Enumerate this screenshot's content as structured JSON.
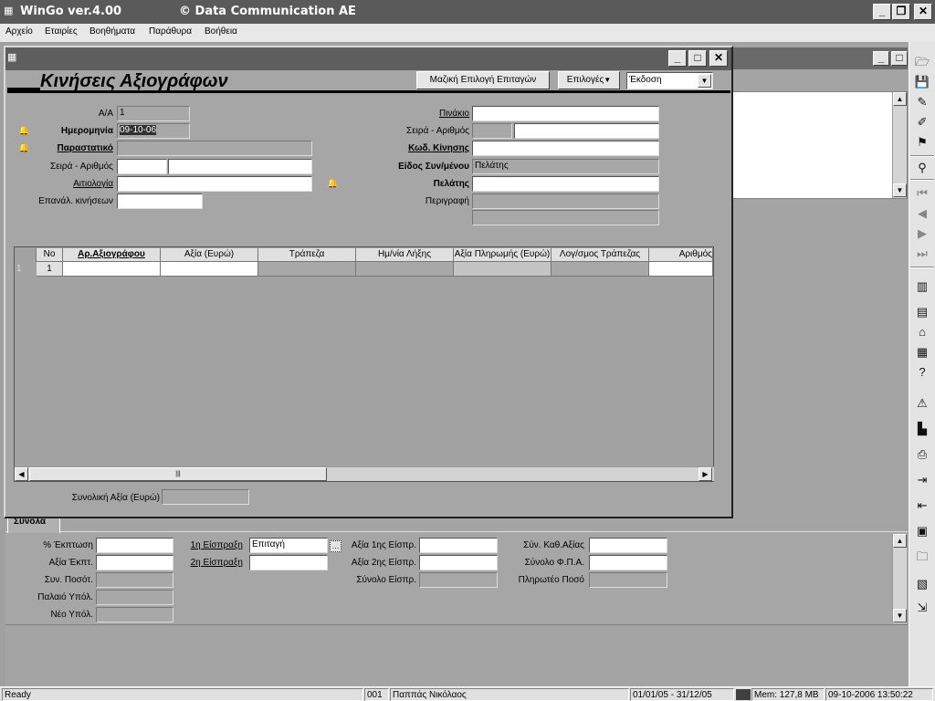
{
  "app": {
    "title": "WinGo ver.4.00",
    "company": "© Data Communication AE"
  },
  "menu": [
    "Αρχείο",
    "Εταιρίες",
    "Βοηθήματα",
    "Παράθυρα",
    "Βοήθεια"
  ],
  "form": {
    "title": "Κινήσεις Αξιογράφων",
    "btn_mass": "Μαζική Επιλογή Επιταγών",
    "btn_options": "Επιλογές",
    "edition": "Έκδοση",
    "left": {
      "aa_label": "Α/Α",
      "aa_value": "1",
      "date_label": "Ημερομηνία",
      "date_value": "09-10-06",
      "parastatiko_label": "Παραστατικό",
      "seira_label": "Σειρά - Αριθμός",
      "aitiologia_label": "Αιτιολογία",
      "epanal_label": "Επανάλ. κινήσεων"
    },
    "right": {
      "pinakio_label": "Πινάκιο",
      "seira_label": "Σειρά - Αριθμός",
      "kod_label": "Κωδ. Κίνησης",
      "eidos_label": "Είδος Συν/μένου",
      "eidos_value": "Πελάτης",
      "pelatis_label": "Πελάτης",
      "perigrafi_label": "Περιγραφή"
    },
    "grid": {
      "headers": [
        "Νο",
        "Αρ.Αξιογράφου",
        "Αξία (Ευρώ)",
        "Τράπεζα",
        "Ημ/νία Λήξης",
        "Αξία Πληρωμής (Ευρώ)",
        "Λογ/σμος Τράπεζας",
        "Αριθμός"
      ],
      "row_index": "1",
      "row_no": "1"
    },
    "total_label": "Συνολική Αξία (Ευρώ)"
  },
  "bottom": {
    "tab": "Σύνολα",
    "col1": [
      "% Έκπτωση",
      "Αξία Έκπτ.",
      "Συν. Ποσότ.",
      "Παλαιό Υπόλ.",
      "Νέο Υπόλ."
    ],
    "eispraxi1_label": "1η Είσπραξη",
    "eispraxi1_value": "Επιταγή",
    "eispraxi2_label": "2η Είσπραξη",
    "col3": [
      "Αξία 1ης Είσπρ.",
      "Αξία 2ης Είσπρ.",
      "Σύνολο Είσπρ."
    ],
    "col4": [
      "Σύν. Καθ.Αξίας",
      "Σύνολο Φ.Π.Α.",
      "Πληρωτέο Ποσό"
    ]
  },
  "status": {
    "ready": "Ready",
    "code": "001",
    "user": "Παππάς Νικόλαος",
    "period": "01/01/05 - 31/12/05",
    "mem": "Mem: 127,8 MB",
    "datetime": "09-10-2006 13:50:22"
  }
}
